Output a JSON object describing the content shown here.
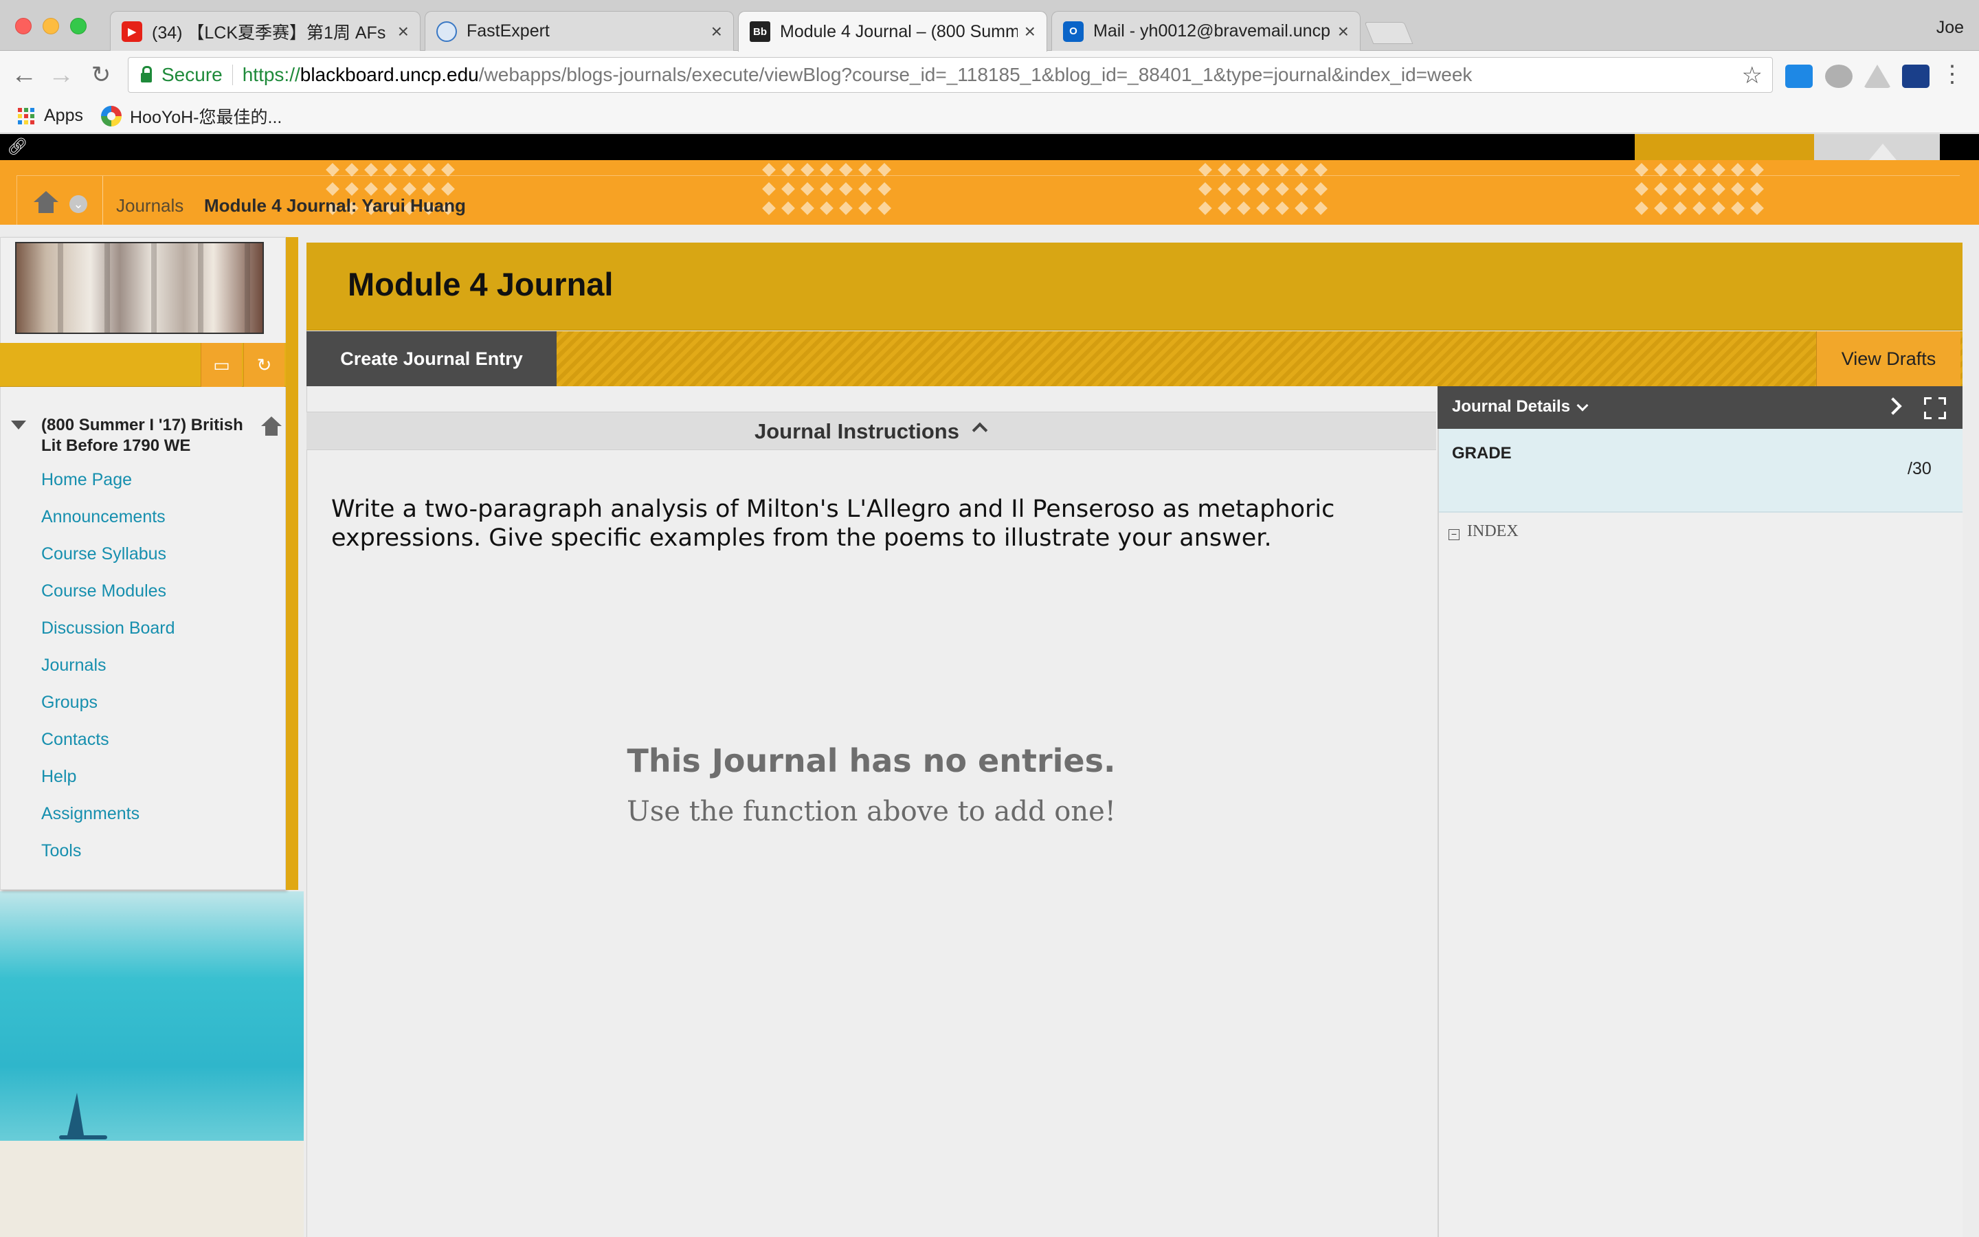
{
  "browser": {
    "tabs": [
      {
        "title": "(34) 【LCK夏季赛】第1周 AFs",
        "icon": "youtube-icon",
        "color": "#e62117"
      },
      {
        "title": "FastExpert",
        "icon": "fastexpert-icon",
        "color": "#3a78c4"
      },
      {
        "title": "Module 4 Journal – (800 Summ",
        "icon": "blackboard-icon",
        "color": "#222222"
      },
      {
        "title": "Mail - yh0012@bravemail.uncp",
        "icon": "outlook-icon",
        "color": "#0a64c8"
      }
    ],
    "profile": "Joe",
    "secure_label": "Secure",
    "url": {
      "scheme": "https://",
      "host": "blackboard.uncp.edu",
      "path": "/webapps/blogs-journals/execute/viewBlog?course_id=_118185_1&blog_id=_88401_1&type=journal&index_id=week"
    },
    "extensions": [
      "lite-extension-icon",
      "puzzle-extension-icon",
      "drive-extension-icon",
      "clapper-extension-icon"
    ],
    "bookmarks": [
      {
        "label": "Apps",
        "icon": "apps-grid-icon"
      },
      {
        "label": "HooYoH-您最佳的...",
        "icon": "hooyoh-icon"
      }
    ]
  },
  "breadcrumb": {
    "items": [
      "Journals",
      "Module 4 Journal: Yarui Huang"
    ]
  },
  "course_menu": {
    "course_title": "(800 Summer I '17) British Lit Before 1790 WE",
    "items": [
      "Home Page",
      "Announcements",
      "Course Syllabus",
      "Course Modules",
      "Discussion Board",
      "Journals",
      "Groups",
      "Contacts",
      "Help",
      "Assignments",
      "Tools"
    ]
  },
  "main": {
    "title": "Module 4 Journal",
    "create_button": "Create Journal Entry",
    "drafts_button": "View Drafts",
    "instructions_label": "Journal Instructions",
    "instructions_text": "Write a two-paragraph analysis of Milton's L'Allegro and Il Penseroso as metaphoric expressions.  Give specific examples from the poems to illustrate your answer.",
    "empty_title": "This Journal has no entries.",
    "empty_subtitle": "Use the function above to add one!"
  },
  "details_panel": {
    "title": "Journal Details",
    "grade_label": "GRADE",
    "grade_value": "/30",
    "index_label": "INDEX"
  },
  "colors": {
    "header_orange": "#f7a224",
    "title_gold": "#d8a614",
    "link_teal": "#168fae",
    "button_dark": "#4b4b4b"
  }
}
